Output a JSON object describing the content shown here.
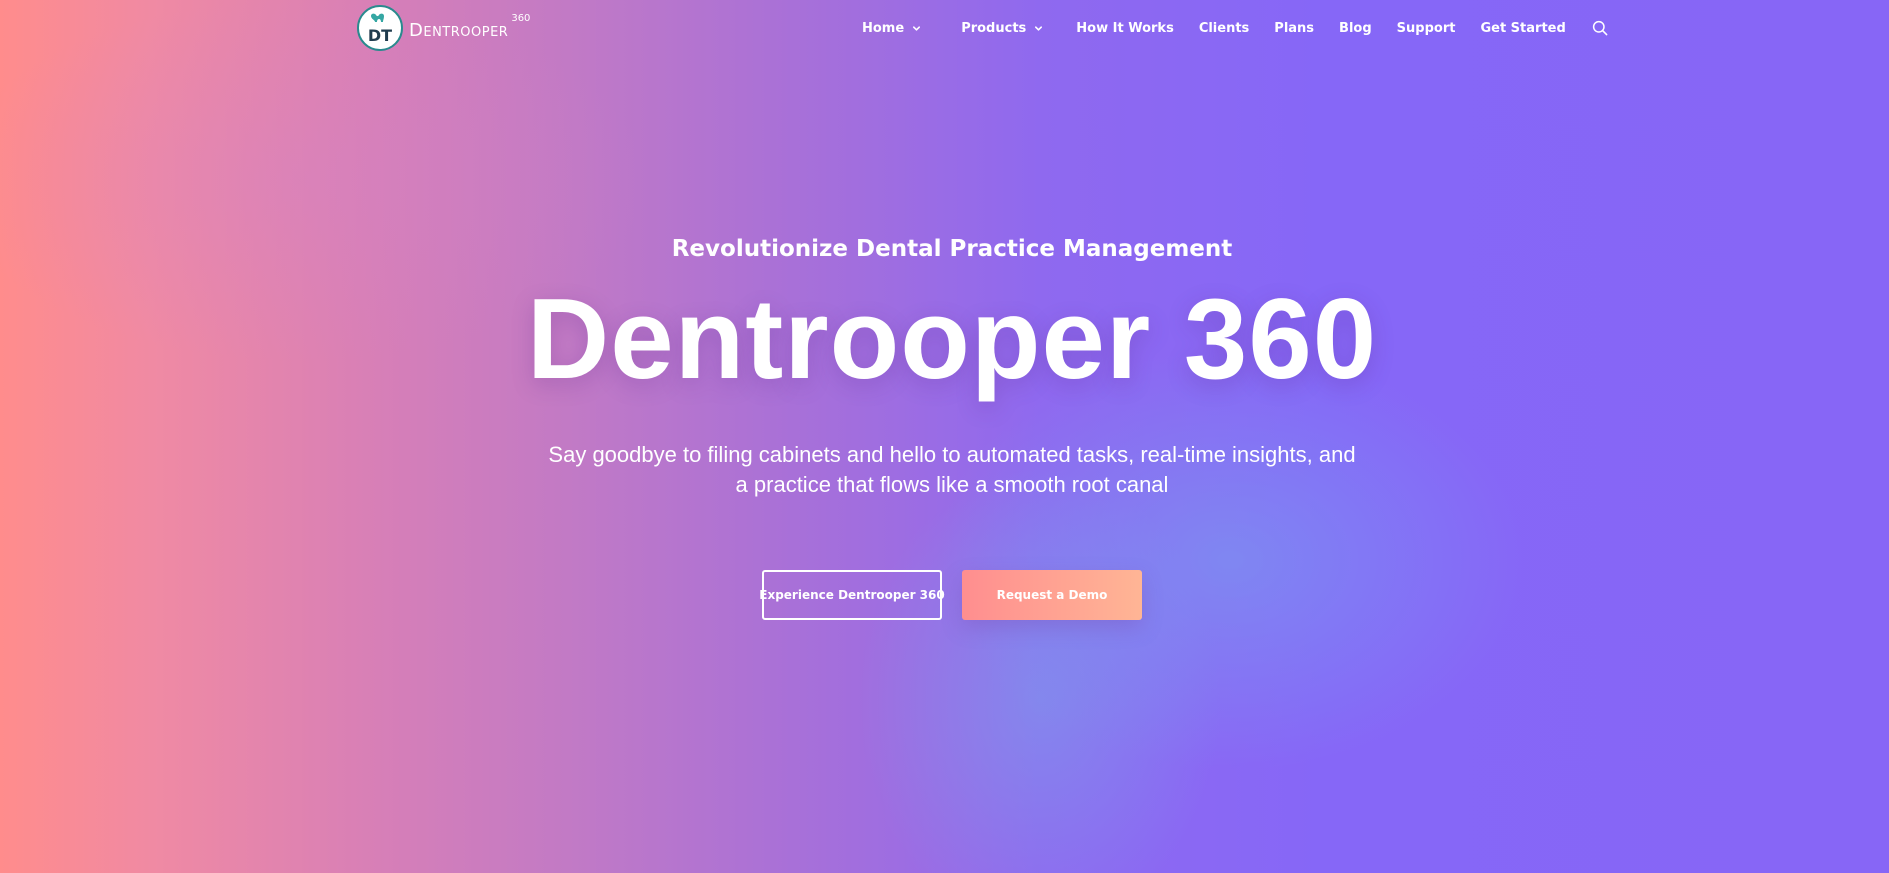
{
  "brand": {
    "name": "Dentrooper",
    "superscript": "360",
    "logo_icon": "tooth-logo-icon",
    "logo_monogram": "DT"
  },
  "nav": {
    "items": [
      {
        "label": "Home",
        "has_dropdown": true
      },
      {
        "label": "Products",
        "has_dropdown": true
      },
      {
        "label": "How It Works",
        "has_dropdown": false
      },
      {
        "label": "Clients",
        "has_dropdown": false
      },
      {
        "label": "Plans",
        "has_dropdown": false
      },
      {
        "label": "Blog",
        "has_dropdown": false
      },
      {
        "label": "Support",
        "has_dropdown": false
      },
      {
        "label": "Get Started",
        "has_dropdown": false
      }
    ],
    "search_icon": "search-icon"
  },
  "hero": {
    "eyebrow": "Revolutionize Dental Practice Management",
    "title": "Dentrooper 360",
    "subtitle": "Say goodbye to filing cabinets and hello to automated tasks, real-time insights, and a practice that flows like a smooth root canal",
    "primary_button": "Experience Dentrooper 360",
    "secondary_button": "Request a Demo"
  },
  "colors": {
    "gradient_left": "#ff8c8c",
    "gradient_mid": "#c27ac5",
    "gradient_right": "#8766f6",
    "cta_start": "#ff8e8f",
    "cta_end": "#ffb595",
    "logo_ring": "#2a8a8e"
  }
}
